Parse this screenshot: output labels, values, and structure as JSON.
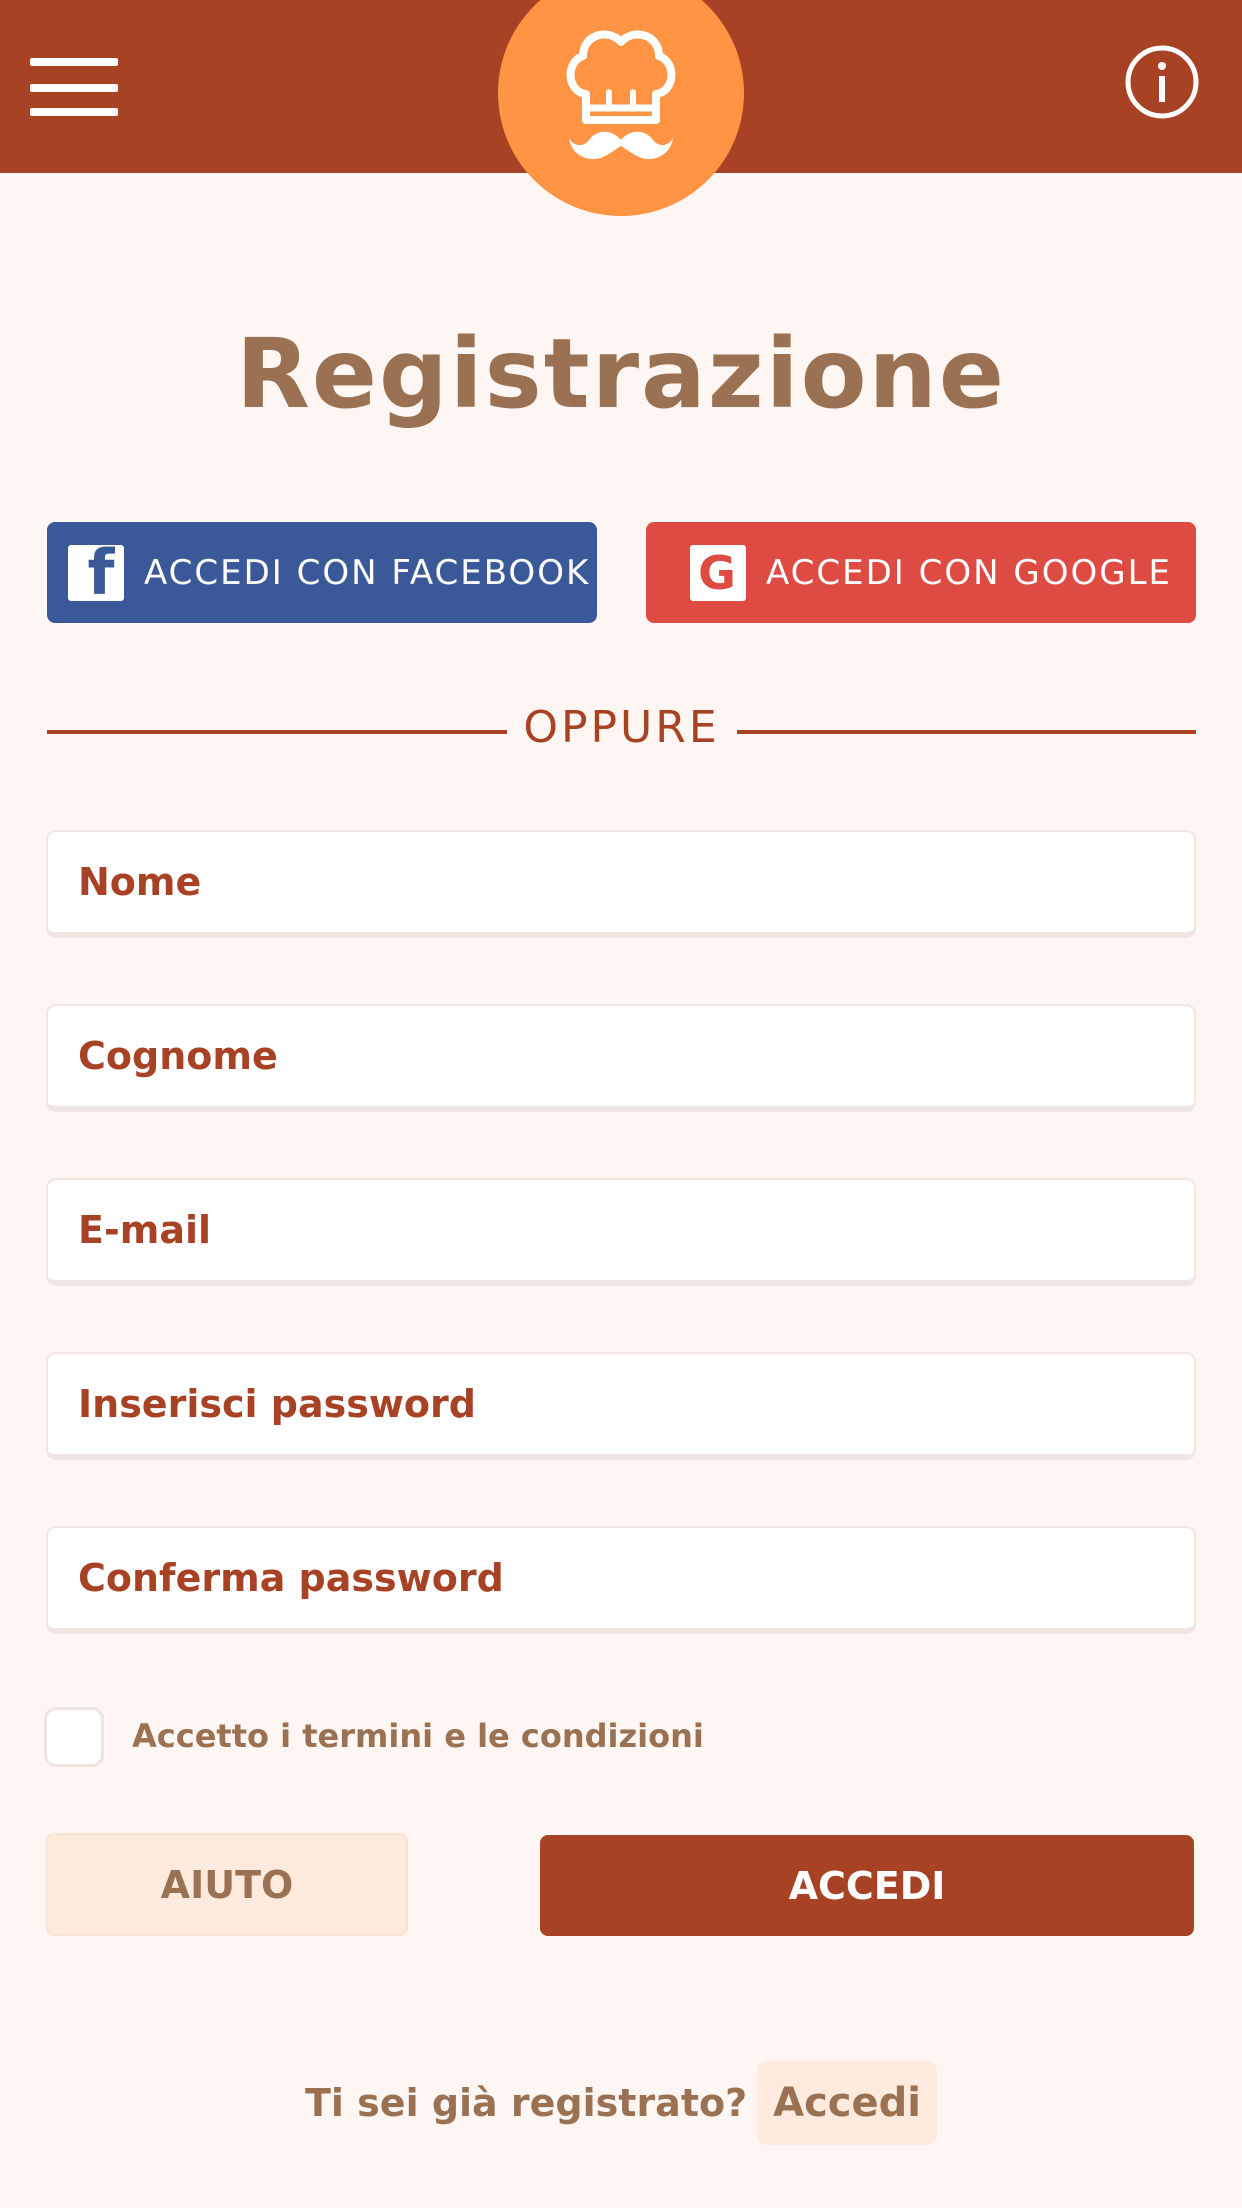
{
  "header": {
    "menu_icon": "hamburger-menu-icon",
    "logo_icon": "chef-hat-mustache-icon",
    "info_icon": "info-circle-icon"
  },
  "page": {
    "title": "Registrazione"
  },
  "social": {
    "facebook_label": "ACCEDI CON FACEBOOK",
    "facebook_icon": "facebook-icon",
    "google_label": "ACCEDI CON GOOGLE",
    "google_icon": "google-icon"
  },
  "divider": {
    "label": "OPPURE"
  },
  "form": {
    "first_name_placeholder": "Nome",
    "last_name_placeholder": "Cognome",
    "email_placeholder": "E-mail",
    "password_placeholder": "Inserisci password",
    "confirm_password_placeholder": "Conferma password",
    "terms_label": "Accetto i termini e le condizioni",
    "terms_checked": false
  },
  "actions": {
    "help_label": "AIUTO",
    "login_label": "ACCEDI"
  },
  "footer": {
    "question": "Ti sei già registrato?",
    "login_link": "Accedi"
  },
  "colors": {
    "brand": "#A84224",
    "logo_bg": "#FF9444",
    "title": "#9A7152",
    "facebook": "#3B5998",
    "google": "#DE4B43",
    "background": "#FDF6F2"
  }
}
